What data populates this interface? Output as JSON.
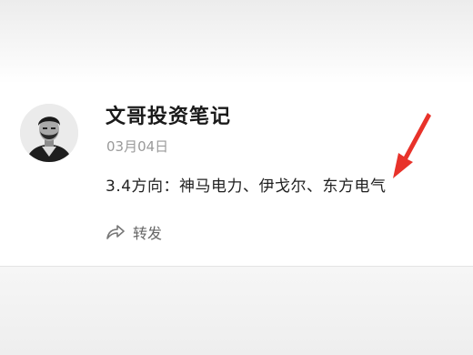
{
  "post": {
    "author_name": "文哥投资笔记",
    "date": "03月04日",
    "text": "3.4方向：神马电力、伊戈尔、东方电气",
    "share_label": "转发"
  },
  "icons": {
    "avatar": "author-avatar",
    "share": "share-icon",
    "annotation": "red-arrow-icon"
  },
  "colors": {
    "annotation_red": "#e8322a",
    "date_gray": "#9a9a9a",
    "share_gray": "#666666"
  }
}
